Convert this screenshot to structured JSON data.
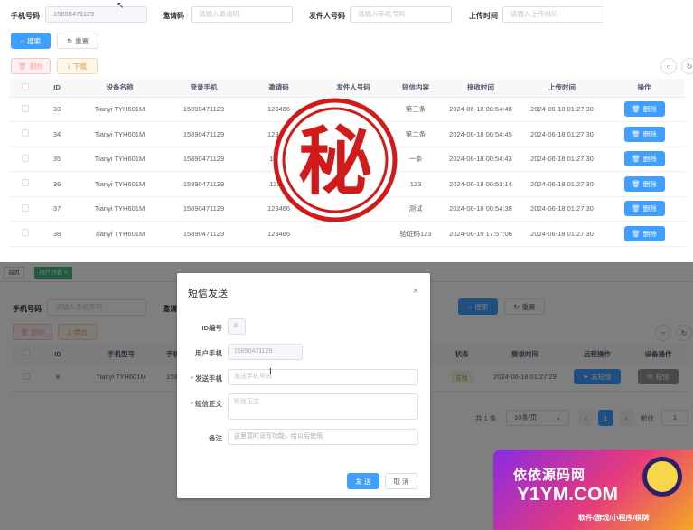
{
  "top_filters": {
    "phone_label": "手机号码",
    "phone_value": "15890471129",
    "invite_label": "邀请码",
    "invite_placeholder": "请输入邀请码",
    "sender_label": "发件人号码",
    "sender_placeholder": "请输入手机号码",
    "upload_label": "上传时间",
    "upload_placeholder": "请输入上传时间",
    "search": "搜索",
    "reset": "重置",
    "delete": "删除",
    "download": "下载"
  },
  "sms_table": {
    "headers": [
      "ID",
      "设备名称",
      "登录手机",
      "邀请码",
      "发件人号码",
      "短信内容",
      "接收时间",
      "上传时间",
      "操作"
    ],
    "rows": [
      [
        "33",
        "Tianyi TYH601M",
        "15890471129",
        "123466",
        "",
        "第三条",
        "2024-06-18 00:54:48",
        "2024-06-18 01:27:30",
        "删除"
      ],
      [
        "34",
        "Tianyi TYH601M",
        "15890471129",
        "123466",
        "",
        "第二条",
        "2024-06-18 00:54:45",
        "2024-06-18 01:27:30",
        "删除"
      ],
      [
        "35",
        "Tianyi TYH601M",
        "15890471129",
        "12346",
        "",
        "一条",
        "2024-06-18 00:54:43",
        "2024-06-18 01:27:30",
        "删除"
      ],
      [
        "36",
        "Tianyi TYH601M",
        "15890471129",
        "12346",
        "",
        "123",
        "2024-06-18 00:53:14",
        "2024-06-18 01:27:30",
        "删除"
      ],
      [
        "37",
        "Tianyi TYH601M",
        "15890471129",
        "123466",
        "",
        "测试",
        "2024-06-18 00:54:38",
        "2024-06-18 01:27:30",
        "删除"
      ],
      [
        "38",
        "Tianyi TYH601M",
        "15890471129",
        "123466",
        "",
        "验证码123",
        "2024-06-10 17:57:06",
        "2024-06-18 01:27:30",
        "删除"
      ]
    ]
  },
  "stamp_char": "秘",
  "bottom": {
    "tags": [
      "首页",
      "用户列表"
    ],
    "phone_label": "手机号码",
    "phone_placeholder": "请输入手机号码",
    "invite_label": "邀请",
    "search": "搜索",
    "reset": "重置",
    "delete": "删除",
    "export": "导出",
    "table_headers": [
      "ID",
      "手机型号",
      "手机号",
      "状态",
      "登录时间",
      "远程操作",
      "设备操作"
    ],
    "row": {
      "id": "8",
      "model": "Tianyi TYH601M",
      "phone": "1589047",
      "status": "在线",
      "login_time": "2024-06-18 01:27:29",
      "remote_op": "发短信",
      "device_op": "短信"
    },
    "pagination": {
      "total": "共 1 条",
      "page_size": "10条/页",
      "current": "1",
      "goto": "前往",
      "goto_value": "1"
    }
  },
  "dialog": {
    "title": "短信发送",
    "id_label": "ID编号",
    "id_value": "8",
    "user_phone_label": "用户手机",
    "user_phone_value": "15890471129",
    "send_phone_label": "发送手机",
    "send_phone_placeholder": "发送手机号码",
    "sms_body_label": "短信正文",
    "sms_body_placeholder": "短信正文",
    "note_label": "备注",
    "note_text": "这里暂时没写功能，给以后使用",
    "send": "发 送",
    "cancel": "取 消"
  },
  "watermark": {
    "cn_name": "依依源码网",
    "domain": "Y1YM.COM",
    "tagline": "软件/游戏/小程序/棋牌"
  },
  "colors": {
    "primary": "#409eff",
    "stamp_red": "#d11a1a",
    "success": "#67c23a"
  }
}
